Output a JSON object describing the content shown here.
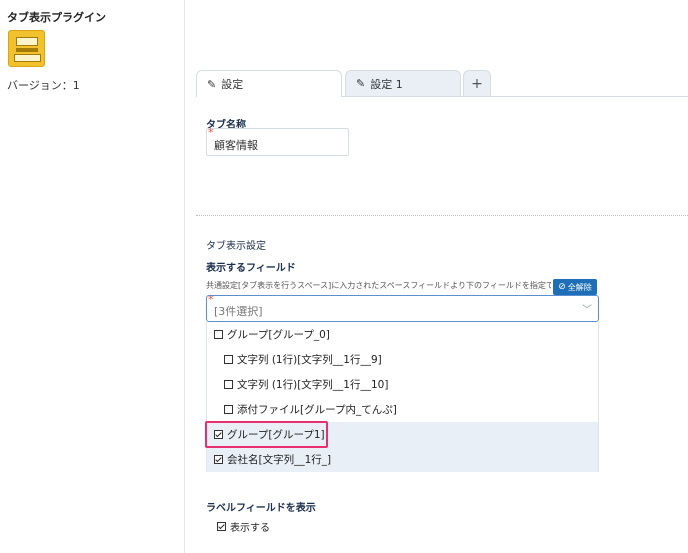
{
  "plugin": {
    "title": "タブ表示プラグイン",
    "version": "バージョン：1"
  },
  "tabs": [
    {
      "label": "設定",
      "active": true
    },
    {
      "label": "設定 1",
      "active": false
    },
    {
      "label": "+",
      "active": false
    }
  ],
  "tab_name": {
    "label": "タブ名称",
    "value": "顧客情報"
  },
  "tab_display": {
    "section_label": "タブ表示設定",
    "fields_label": "表示するフィールド",
    "description": "共通設定[タブ表示を行うスペース]に入力されたスペースフィールドより下のフィールドを指定で",
    "clear_all": "全解除",
    "select_value": "[3件選択]",
    "options": [
      {
        "label": "グループ[グループ_0]",
        "checked": false
      },
      {
        "label": "文字列 (1行)[文字列__1行__9]",
        "checked": false
      },
      {
        "label": "文字列 (1行)[文字列__1行__10]",
        "checked": false
      },
      {
        "label": "添付ファイル[グループ内_てんぷ]",
        "checked": false
      },
      {
        "label": "グループ[グループ1]",
        "checked": true
      },
      {
        "label": "会社名[文字列__1行_]",
        "checked": true
      }
    ]
  },
  "label_field": {
    "label": "ラベルフィールドを表示",
    "checkbox_label": "表示する",
    "checked": true
  }
}
